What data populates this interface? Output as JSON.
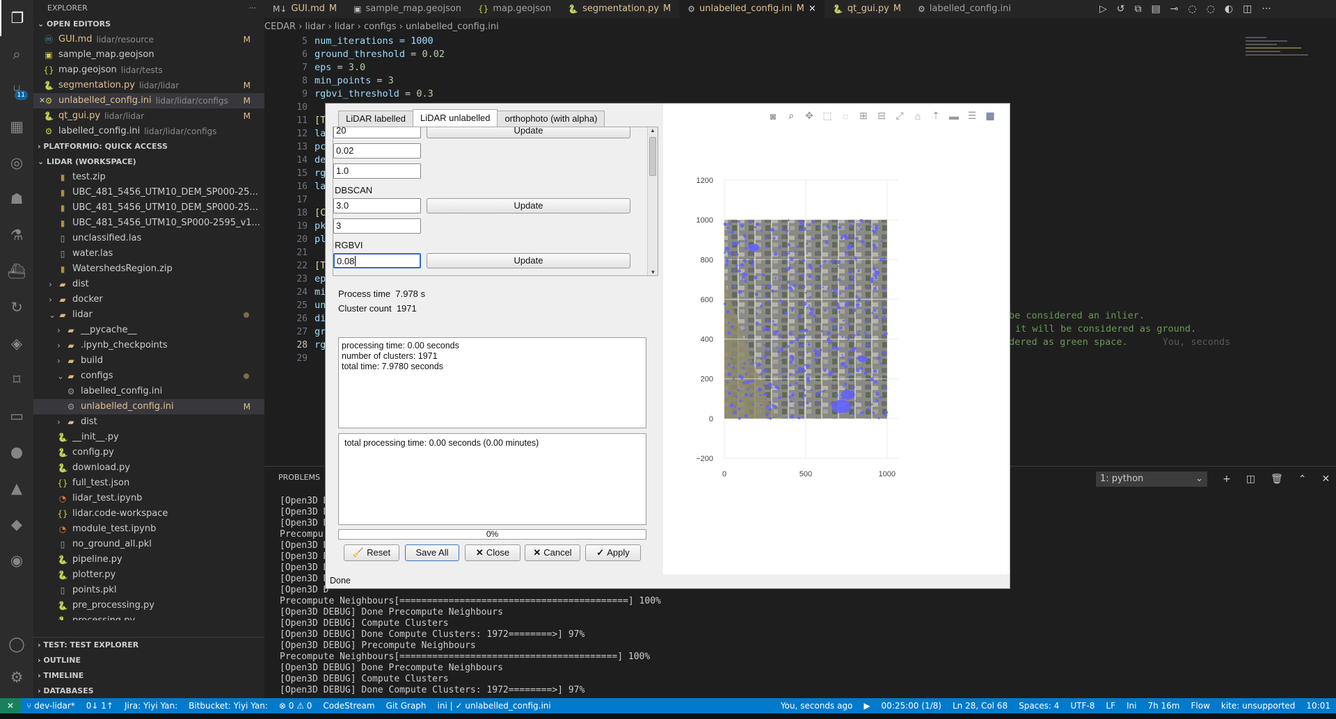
{
  "editor_tabs": [
    {
      "label": "GUI.md",
      "mark": "M",
      "icon": "markdown-icon"
    },
    {
      "label": "sample_map.geojson",
      "mark": "",
      "icon": "map-icon"
    },
    {
      "label": "map.geojson",
      "mark": "",
      "icon": "json-icon"
    },
    {
      "label": "segmentation.py",
      "mark": "M",
      "icon": "python-icon"
    },
    {
      "label": "unlabelled_config.ini",
      "mark": "M",
      "icon": "gear-icon",
      "close": "×"
    },
    {
      "label": "qt_gui.py",
      "mark": "M",
      "icon": "python-icon"
    },
    {
      "label": "labelled_config.ini",
      "mark": "",
      "icon": "gear-icon"
    }
  ],
  "breadcrumb": [
    "CEDAR",
    "lidar",
    "lidar",
    "configs",
    "unlabelled_config.ini"
  ],
  "explorer": {
    "title": "EXPLORER",
    "more": "···",
    "open_editors_label": "OPEN EDITORS",
    "open_editors": [
      {
        "name": "GUI.md",
        "path": "lidar/resource",
        "mark": "M"
      },
      {
        "name": "sample_map.geojson",
        "path": "",
        "mark": ""
      },
      {
        "name": "map.geojson",
        "path": "lidar/tests",
        "mark": ""
      },
      {
        "name": "segmentation.py",
        "path": "lidar/lidar",
        "mark": "M"
      },
      {
        "name": "unlabelled_config.ini",
        "path": "lidar/lidar/configs",
        "mark": "M"
      },
      {
        "name": "qt_gui.py",
        "path": "lidar/lidar",
        "mark": "M"
      },
      {
        "name": "labelled_config.ini",
        "path": "lidar/lidar/configs",
        "mark": ""
      }
    ],
    "platformio_label": "PLATFORMIO: QUICK ACCESS",
    "workspace_label": "LIDAR (WORKSPACE)",
    "files": [
      {
        "name": "test.zip",
        "indent": 2
      },
      {
        "name": "UBC_481_5456_UTM10_DEM_SP000-25...",
        "indent": 2
      },
      {
        "name": "UBC_481_5456_UTM10_DEM_SP000-25...",
        "indent": 2
      },
      {
        "name": "UBC_481_5456_UTM10_SP000-2595_v1...",
        "indent": 2
      },
      {
        "name": "unclassified.las",
        "indent": 2
      },
      {
        "name": "water.las",
        "indent": 2
      },
      {
        "name": "WatershedsRegion.zip",
        "indent": 2
      },
      {
        "name": "dist",
        "indent": 1,
        "folder": true
      },
      {
        "name": "docker",
        "indent": 1,
        "folder": true
      },
      {
        "name": "lidar",
        "indent": 1,
        "folder": true,
        "open": true,
        "dot": true
      },
      {
        "name": "__pycache__",
        "indent": 2,
        "folder": true
      },
      {
        "name": ".ipynb_checkpoints",
        "indent": 2,
        "folder": true
      },
      {
        "name": "build",
        "indent": 2,
        "folder": true
      },
      {
        "name": "configs",
        "indent": 2,
        "folder": true,
        "open": true,
        "dot": true
      },
      {
        "name": "labelled_config.ini",
        "indent": 3
      },
      {
        "name": "unlabelled_config.ini",
        "indent": 3,
        "mark": "M",
        "sel": true
      },
      {
        "name": "dist",
        "indent": 2,
        "folder": true
      },
      {
        "name": "__init__.py",
        "indent": 2
      },
      {
        "name": "config.py",
        "indent": 2
      },
      {
        "name": "download.py",
        "indent": 2
      },
      {
        "name": "full_test.json",
        "indent": 2
      },
      {
        "name": "lidar_test.ipynb",
        "indent": 2
      },
      {
        "name": "lidar.code-workspace",
        "indent": 2
      },
      {
        "name": "module_test.ipynb",
        "indent": 2
      },
      {
        "name": "no_ground_all.pkl",
        "indent": 2
      },
      {
        "name": "pipeline.py",
        "indent": 2
      },
      {
        "name": "plotter.py",
        "indent": 2
      },
      {
        "name": "points.pkl",
        "indent": 2
      },
      {
        "name": "pre_processing.py",
        "indent": 2
      },
      {
        "name": "processing.py",
        "indent": 2
      },
      {
        "name": "qt_gui.py",
        "indent": 2,
        "mark": "M"
      }
    ],
    "bottom_sections": [
      "TEST: TEST EXPLORER",
      "OUTLINE",
      "TIMELINE",
      "DATABASES"
    ]
  },
  "code_lines": [
    {
      "n": "5",
      "text": "num_iterations = 1000"
    },
    {
      "n": "6",
      "k": "ground_threshold",
      "v": "0.02"
    },
    {
      "n": "7",
      "k": "eps",
      "v": "3.0"
    },
    {
      "n": "8",
      "k": "min_points",
      "v": "3"
    },
    {
      "n": "9",
      "k": "rgbvi_threshold",
      "v": "0.3"
    },
    {
      "n": "10",
      "text": ""
    },
    {
      "n": "11",
      "text": "[T"
    },
    {
      "n": "12",
      "text": "la"
    },
    {
      "n": "13",
      "text": "pc"
    },
    {
      "n": "14",
      "text": "de"
    },
    {
      "n": "15",
      "text": "rg"
    },
    {
      "n": "16",
      "text": "la"
    },
    {
      "n": "17",
      "text": ""
    },
    {
      "n": "18",
      "text": "[C"
    },
    {
      "n": "19",
      "text": "pk"
    },
    {
      "n": "20",
      "text": "pl"
    },
    {
      "n": "21",
      "text": ""
    },
    {
      "n": "22",
      "text": "[T"
    },
    {
      "n": "23",
      "text": "ep"
    },
    {
      "n": "24",
      "text": "mi"
    },
    {
      "n": "25",
      "text": "un"
    },
    {
      "n": "26",
      "text": "di"
    },
    {
      "n": "27",
      "text": "gr"
    },
    {
      "n": "28",
      "text": "rg"
    },
    {
      "n": "29",
      "text": ""
    }
  ],
  "code_comments": [
    "be considered an inlier.",
    "it will be considered as ground.",
    "dered as green space."
  ],
  "blame": "You, seconds",
  "panel": {
    "tab": "PROBLEMS",
    "terminal_select": "1: python",
    "lines": [
      "[Open3D D",
      "[Open3D D",
      "[Open3D D",
      "Precompu",
      "[Open3D D",
      "[Open3D D",
      "[Open3D D",
      "[Open3D D",
      "[Open3D D",
      "Precompute Neighbours[==========================================] 100%",
      "[Open3D DEBUG] Done Precompute Neighbours",
      "[Open3D DEBUG] Compute Clusters",
      "[Open3D DEBUG] Done Compute Clusters: 1972========>] 97%",
      "[Open3D DEBUG] Precompute Neighbours",
      "Precompute Neighbours[========================================] 100%",
      "[Open3D DEBUG] Done Precompute Neighbours",
      "[Open3D DEBUG] Compute Clusters",
      "[Open3D DEBUG] Done Compute Clusters: 1972========>] 97%"
    ]
  },
  "status": {
    "branch": "dev-lidar*",
    "sync": "0↓ 1↑",
    "jira": "Jira: Yiyi Yan:",
    "bitbucket": "Bitbucket: Yiyi Yan:",
    "problems": "⊗ 0 ⚠ 0",
    "codestream": "CodeStream",
    "gitgraph": "Git Graph",
    "lang_file": "ini | ✓ unlabelled_config.ini",
    "blame": "You, seconds ago",
    "timer": "00:25:00 (1/8)",
    "position": "Ln 28, Col 68",
    "spaces": "Spaces: 4",
    "encoding": "UTF-8",
    "eol": "LF",
    "language": "Ini",
    "time_spent": "7h 16m",
    "flow": "Flow",
    "kite": "kite: unsupported",
    "clock": "10:01"
  },
  "dialog": {
    "tabs": [
      "LiDAR labelled",
      "LiDAR unlabelled",
      "orthophoto (with alpha)"
    ],
    "active_tab": 1,
    "params": {
      "top_value": "20",
      "v2": "0.02",
      "v3": "1.0",
      "dbscan_label": "DBSCAN",
      "eps": "3.0",
      "min_points": "3",
      "rgbvi_label": "RGBVI",
      "rgbvi": "0.08",
      "update": "Update"
    },
    "process_time_label": "Process time",
    "process_time": "7.978 s",
    "cluster_count_label": "Cluster count",
    "cluster_count": "1971",
    "log1": [
      "processing time: 0.00 seconds",
      "number of clusters: 1971",
      "total time: 7.9780 seconds"
    ],
    "log2": [
      "total processing time: 0.00 seconds (0.00 minutes)"
    ],
    "progress": "0%",
    "progress_value": 0,
    "buttons": {
      "reset": "Reset",
      "save_all": "Save All",
      "close": "Close",
      "cancel": "Cancel",
      "apply": "Apply"
    },
    "status": "Done"
  },
  "chart_data": {
    "type": "scatter",
    "description_source": "orthophoto image with blue cluster points",
    "x_ticks": [
      "0",
      "500",
      "1000"
    ],
    "y_ticks": [
      "1200",
      "1000",
      "800",
      "600",
      "400",
      "200",
      "0",
      "−200"
    ],
    "xlim": [
      0,
      1000
    ],
    "ylim": [
      -200,
      1200
    ],
    "image_extent": {
      "x": [
        0,
        1000
      ],
      "y": [
        0,
        1000
      ]
    },
    "point_color": "#6363fa",
    "grid": true
  }
}
